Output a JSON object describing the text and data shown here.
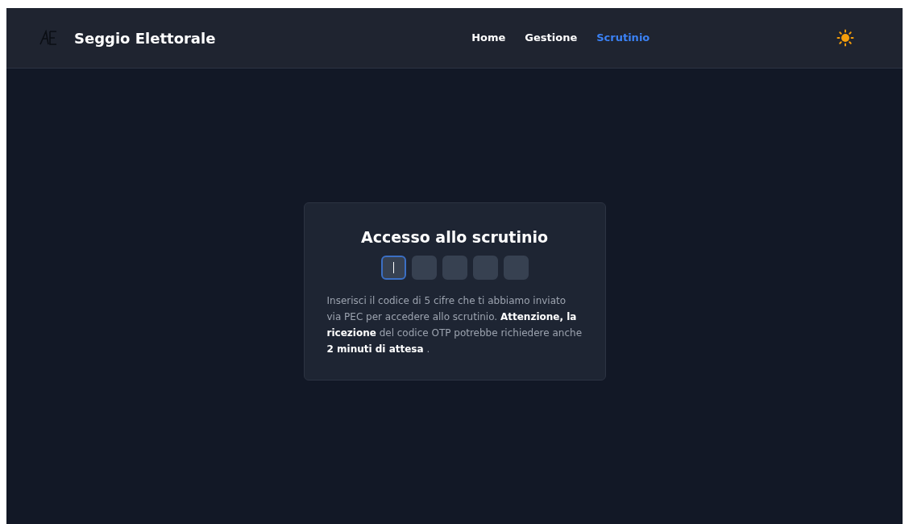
{
  "header": {
    "title": "Seggio Elettorale",
    "nav": [
      {
        "label": "Home",
        "selected": false
      },
      {
        "label": "Gestione",
        "selected": false
      },
      {
        "label": "Scrutinio",
        "selected": true
      }
    ]
  },
  "card": {
    "title": "Accesso allo scrutinio",
    "otp": [
      {
        "selected": true
      },
      {
        "selected": false
      },
      {
        "selected": false
      },
      {
        "selected": false
      },
      {
        "selected": false
      }
    ],
    "message": "Inserisci il codice di 5 cifre che ti abbiamo inviato via PEC per accedere allo scrutinio. **Attenzione, la ricezione** del codice OTP potrebbe richiedere anche **2 minuti di attesa** ."
  }
}
